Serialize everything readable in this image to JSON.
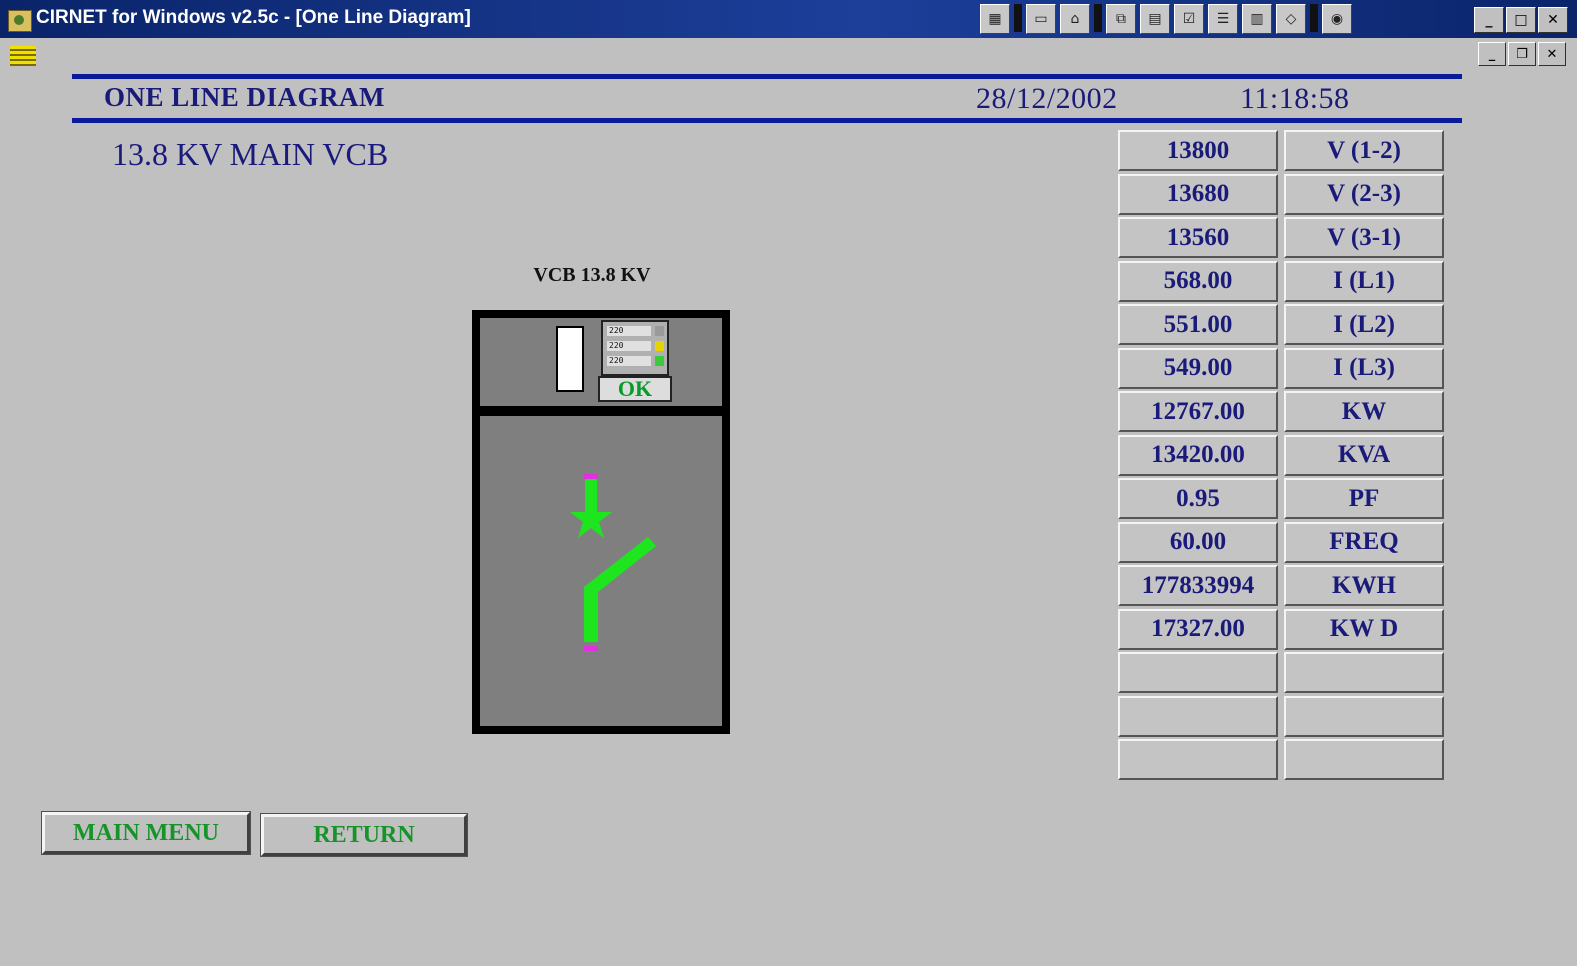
{
  "window": {
    "title": "CIRNET for Windows v2.5c - [One Line Diagram]",
    "controls": {
      "minimize": "_",
      "maximize": "□",
      "close": "✕"
    },
    "child_controls": {
      "minimize": "_",
      "restore": "❐",
      "close": "✕"
    }
  },
  "toolbar": {
    "icons": [
      "grid-icon",
      "page-icon",
      "folder-open-icon",
      "copy-icon",
      "calendar-icon",
      "checklist-icon",
      "form-icon",
      "report-icon",
      "eraser-icon",
      "help-icon"
    ]
  },
  "header": {
    "title": "ONE LINE DIAGRAM",
    "date": "28/12/2002",
    "time": "11:18:58"
  },
  "section_title": "13.8 KV MAIN VCB",
  "breaker": {
    "label": "VCB 13.8 KV",
    "status": "OK",
    "relay_readings": [
      "220",
      "220",
      "220"
    ],
    "state": "closed",
    "colors": {
      "energized": "#1ee61e",
      "terminal": "#e030e0",
      "status_text": "#0a9a2a"
    }
  },
  "readings": [
    {
      "value": "13800",
      "label": "V (1-2)"
    },
    {
      "value": "13680",
      "label": "V (2-3)"
    },
    {
      "value": "13560",
      "label": "V (3-1)"
    },
    {
      "value": "568.00",
      "label": "I (L1)"
    },
    {
      "value": "551.00",
      "label": "I (L2)"
    },
    {
      "value": "549.00",
      "label": "I (L3)"
    },
    {
      "value": "12767.00",
      "label": "KW"
    },
    {
      "value": "13420.00",
      "label": "KVA"
    },
    {
      "value": "0.95",
      "label": "PF"
    },
    {
      "value": "60.00",
      "label": "FREQ"
    },
    {
      "value": "177833994",
      "label": "KWH"
    },
    {
      "value": "17327.00",
      "label": "KW D"
    },
    {
      "value": "",
      "label": ""
    },
    {
      "value": "",
      "label": ""
    },
    {
      "value": "",
      "label": ""
    }
  ],
  "buttons": {
    "main_menu": "MAIN MENU",
    "return": "RETURN"
  },
  "colors": {
    "background": "#c0c0c0",
    "heading_text": "#1a1a7a",
    "header_rule": "#0b1a9a",
    "button_text": "#16942a"
  }
}
